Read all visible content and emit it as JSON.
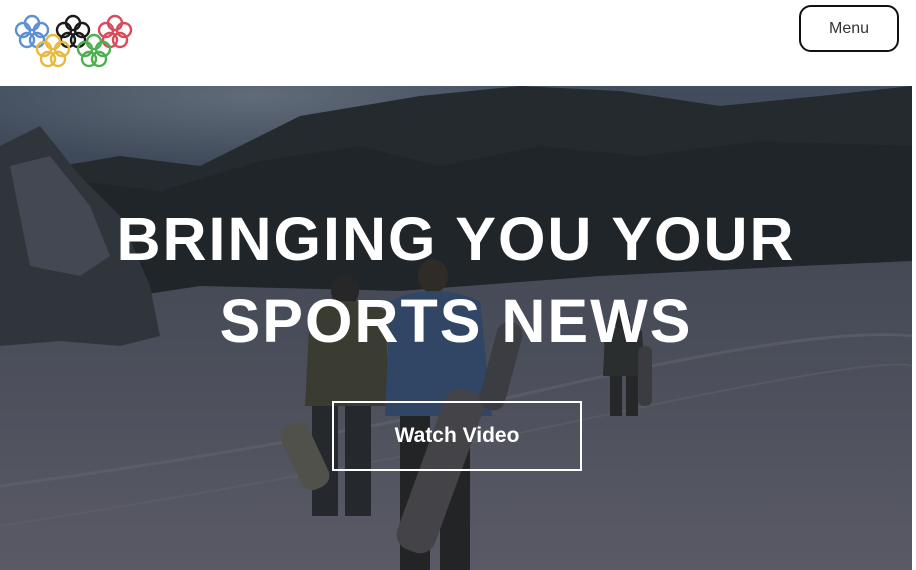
{
  "header": {
    "logo_icon": "rings-logo-icon",
    "menu_label": "Menu"
  },
  "hero": {
    "title_line1": "BRINGING YOU YOUR",
    "title_line2": "SPORTS NEWS",
    "watch_button_label": "Watch Video",
    "background_image": "snowboarders-walking-in-snow-photo"
  },
  "colors": {
    "ring_blue": "#5b8fd6",
    "ring_black": "#1a1a1a",
    "ring_red": "#d94a5a",
    "ring_yellow": "#e8b93a",
    "ring_green": "#4caf50",
    "overlay": "#2b2f38"
  }
}
